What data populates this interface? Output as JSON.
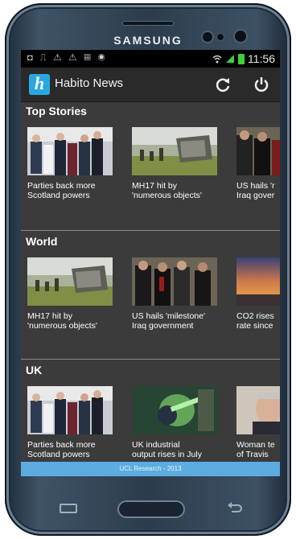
{
  "device": {
    "brand": "SAMSUNG"
  },
  "status_bar": {
    "time": "11:56",
    "left_icons": "◘ ⎍ ⚠ ⚠ ▦ ◉"
  },
  "app_bar": {
    "title": "Habito News",
    "logo_letter": "h",
    "refresh_icon": "refresh-icon",
    "power_icon": "power-icon"
  },
  "sections": [
    {
      "title": "Top Stories",
      "items": [
        {
          "headline": "Parties back more\nScotland powers",
          "image": "group-photo"
        },
        {
          "headline": "MH17 hit by\n'numerous objects'",
          "image": "wreckage-field"
        },
        {
          "headline": "US hails 'r\nIraq gover",
          "image": "officials-group"
        }
      ]
    },
    {
      "title": "World",
      "items": [
        {
          "headline": "MH17 hit by\n'numerous objects'",
          "image": "wreckage-field"
        },
        {
          "headline": "US hails 'milestone'\nIraq government",
          "image": "officials-group"
        },
        {
          "headline": "CO2 rises\nrate since",
          "image": "sunset-sky"
        }
      ]
    },
    {
      "title": "UK",
      "items": [
        {
          "headline": "Parties back more\nScotland powers",
          "image": "group-photo"
        },
        {
          "headline": "UK industrial\noutput rises in July",
          "image": "industrial-worker"
        },
        {
          "headline": "Woman te\nof Travis",
          "image": "older-man-portrait"
        }
      ]
    }
  ],
  "footer": {
    "text": "UCL Research - 2013"
  },
  "colors": {
    "accent": "#2ba7e0",
    "screen_bg": "#3b3b3b",
    "footer_bg": "#5dace0"
  }
}
